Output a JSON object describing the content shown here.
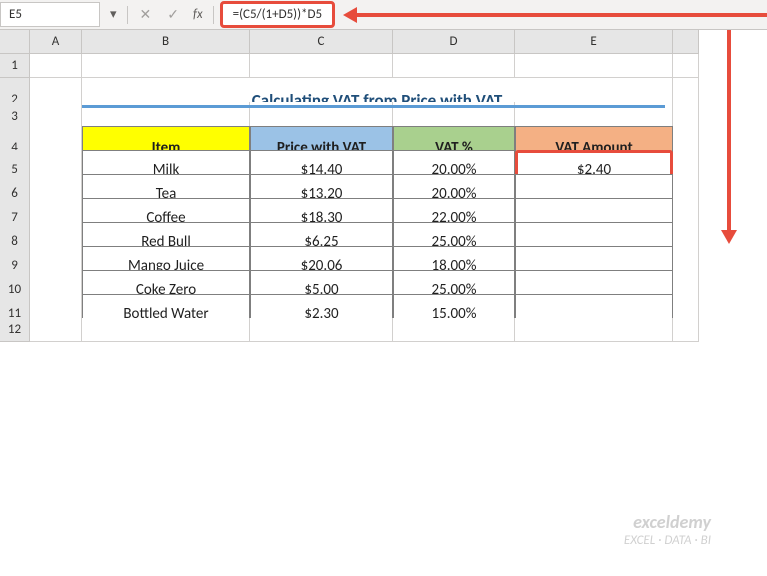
{
  "nameBox": "E5",
  "formula": "=(C5/(1+D5))*D5",
  "fxLabel": "fx",
  "columns": [
    "A",
    "B",
    "C",
    "D",
    "E",
    ""
  ],
  "rows": [
    "1",
    "2",
    "3",
    "4",
    "5",
    "6",
    "7",
    "8",
    "9",
    "10",
    "11",
    "12"
  ],
  "title": "Calculating VAT from Price with VAT",
  "headers": {
    "item": "Item",
    "price": "Price with VAT",
    "vatp": "VAT %",
    "vata": "VAT Amount"
  },
  "table": [
    {
      "item": "Milk",
      "price": "$14.40",
      "vatp": "20.00%",
      "vata": "$2.40"
    },
    {
      "item": "Tea",
      "price": "$13.20",
      "vatp": "20.00%",
      "vata": ""
    },
    {
      "item": "Coffee",
      "price": "$18.30",
      "vatp": "22.00%",
      "vata": ""
    },
    {
      "item": "Red Bull",
      "price": "$6.25",
      "vatp": "25.00%",
      "vata": ""
    },
    {
      "item": "Mango Juice",
      "price": "$20.06",
      "vatp": "18.00%",
      "vata": ""
    },
    {
      "item": "Coke Zero",
      "price": "$5.00",
      "vatp": "25.00%",
      "vata": ""
    },
    {
      "item": "Bottled Water",
      "price": "$2.30",
      "vatp": "15.00%",
      "vata": ""
    }
  ],
  "watermark": {
    "big": "exceldemy",
    "small": "EXCEL · DATA · BI"
  },
  "chart_data": {
    "type": "table",
    "title": "Calculating VAT from Price with VAT",
    "columns": [
      "Item",
      "Price with VAT",
      "VAT %",
      "VAT Amount"
    ],
    "rows": [
      [
        "Milk",
        14.4,
        0.2,
        2.4
      ],
      [
        "Tea",
        13.2,
        0.2,
        null
      ],
      [
        "Coffee",
        18.3,
        0.22,
        null
      ],
      [
        "Red Bull",
        6.25,
        0.25,
        null
      ],
      [
        "Mango Juice",
        20.06,
        0.18,
        null
      ],
      [
        "Coke Zero",
        5.0,
        0.25,
        null
      ],
      [
        "Bottled Water",
        2.3,
        0.15,
        null
      ]
    ]
  }
}
